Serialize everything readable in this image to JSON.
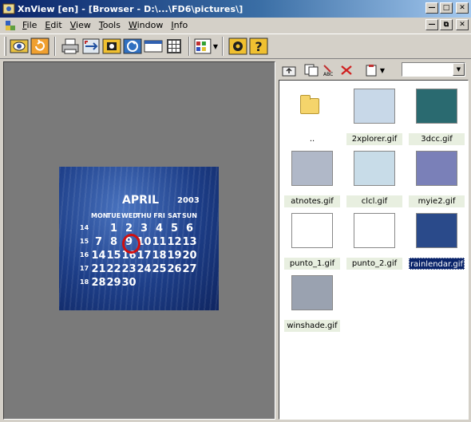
{
  "window": {
    "title": "XnView [en] - [Browser - D:\\...\\FD6\\pictures\\]",
    "buttons": [
      "minimize",
      "maximize",
      "close"
    ]
  },
  "menubar": {
    "items": [
      {
        "label": "File",
        "accel": "F",
        "rest": "ile"
      },
      {
        "label": "Edit",
        "accel": "E",
        "rest": "dit"
      },
      {
        "label": "View",
        "accel": "V",
        "rest": "iew"
      },
      {
        "label": "Tools",
        "accel": "T",
        "rest": "ools"
      },
      {
        "label": "Window",
        "accel": "W",
        "rest": "indow"
      },
      {
        "label": "Info",
        "accel": "I",
        "rest": "nfo"
      }
    ]
  },
  "toolbar": {
    "buttons": [
      "browser-icon",
      "refresh-icon",
      "print-icon",
      "convert-icon",
      "slideshow-icon",
      "capture-icon",
      "html-icon",
      "grid-icon",
      "view-mode-icon",
      "settings-icon",
      "help-icon"
    ],
    "html_label": "HTML"
  },
  "viewer": {
    "calendar": {
      "month": "APRIL",
      "year": "2003",
      "weekdays": [
        "MON",
        "TUE",
        "WED",
        "THU",
        "FRI",
        "SAT",
        "SUN"
      ],
      "weeknums": [
        "14",
        "15",
        "16",
        "17",
        "18"
      ],
      "rows": [
        [
          "",
          "1",
          "2",
          "3",
          "4",
          "5",
          "6"
        ],
        [
          "7",
          "8",
          "9",
          "10",
          "11",
          "12",
          "13"
        ],
        [
          "14",
          "15",
          "16",
          "17",
          "18",
          "19",
          "20"
        ],
        [
          "21",
          "22",
          "23",
          "24",
          "25",
          "26",
          "27"
        ],
        [
          "28",
          "29",
          "30",
          "",
          "",
          "",
          ""
        ]
      ],
      "today": "9"
    }
  },
  "browser_toolbar": {
    "path_value": ""
  },
  "files": [
    {
      "name": "..",
      "kind": "folder"
    },
    {
      "name": "2xplorer.gif",
      "kind": "image",
      "color": "#c8d8e8"
    },
    {
      "name": "3dcc.gif",
      "kind": "image",
      "color": "#2a6a70"
    },
    {
      "name": "atnotes.gif",
      "kind": "image",
      "color": "#b0b8c8"
    },
    {
      "name": "clcl.gif",
      "kind": "image",
      "color": "#c8dce8"
    },
    {
      "name": "myie2.gif",
      "kind": "image",
      "color": "#7a80b8"
    },
    {
      "name": "punto_1.gif",
      "kind": "image",
      "color": "#ffffff"
    },
    {
      "name": "punto_2.gif",
      "kind": "image",
      "color": "#ffffff"
    },
    {
      "name": "rainlendar.gif",
      "kind": "image",
      "color": "#2a4a8a",
      "selected": true
    },
    {
      "name": "winshade.gif",
      "kind": "image",
      "color": "#9aa2b0"
    }
  ],
  "colors": {
    "titlebar_start": "#0a246a",
    "titlebar_end": "#a6caf0",
    "face": "#d4d0c8",
    "viewer_bg": "#7a7a7a",
    "selection": "#0a246a"
  }
}
